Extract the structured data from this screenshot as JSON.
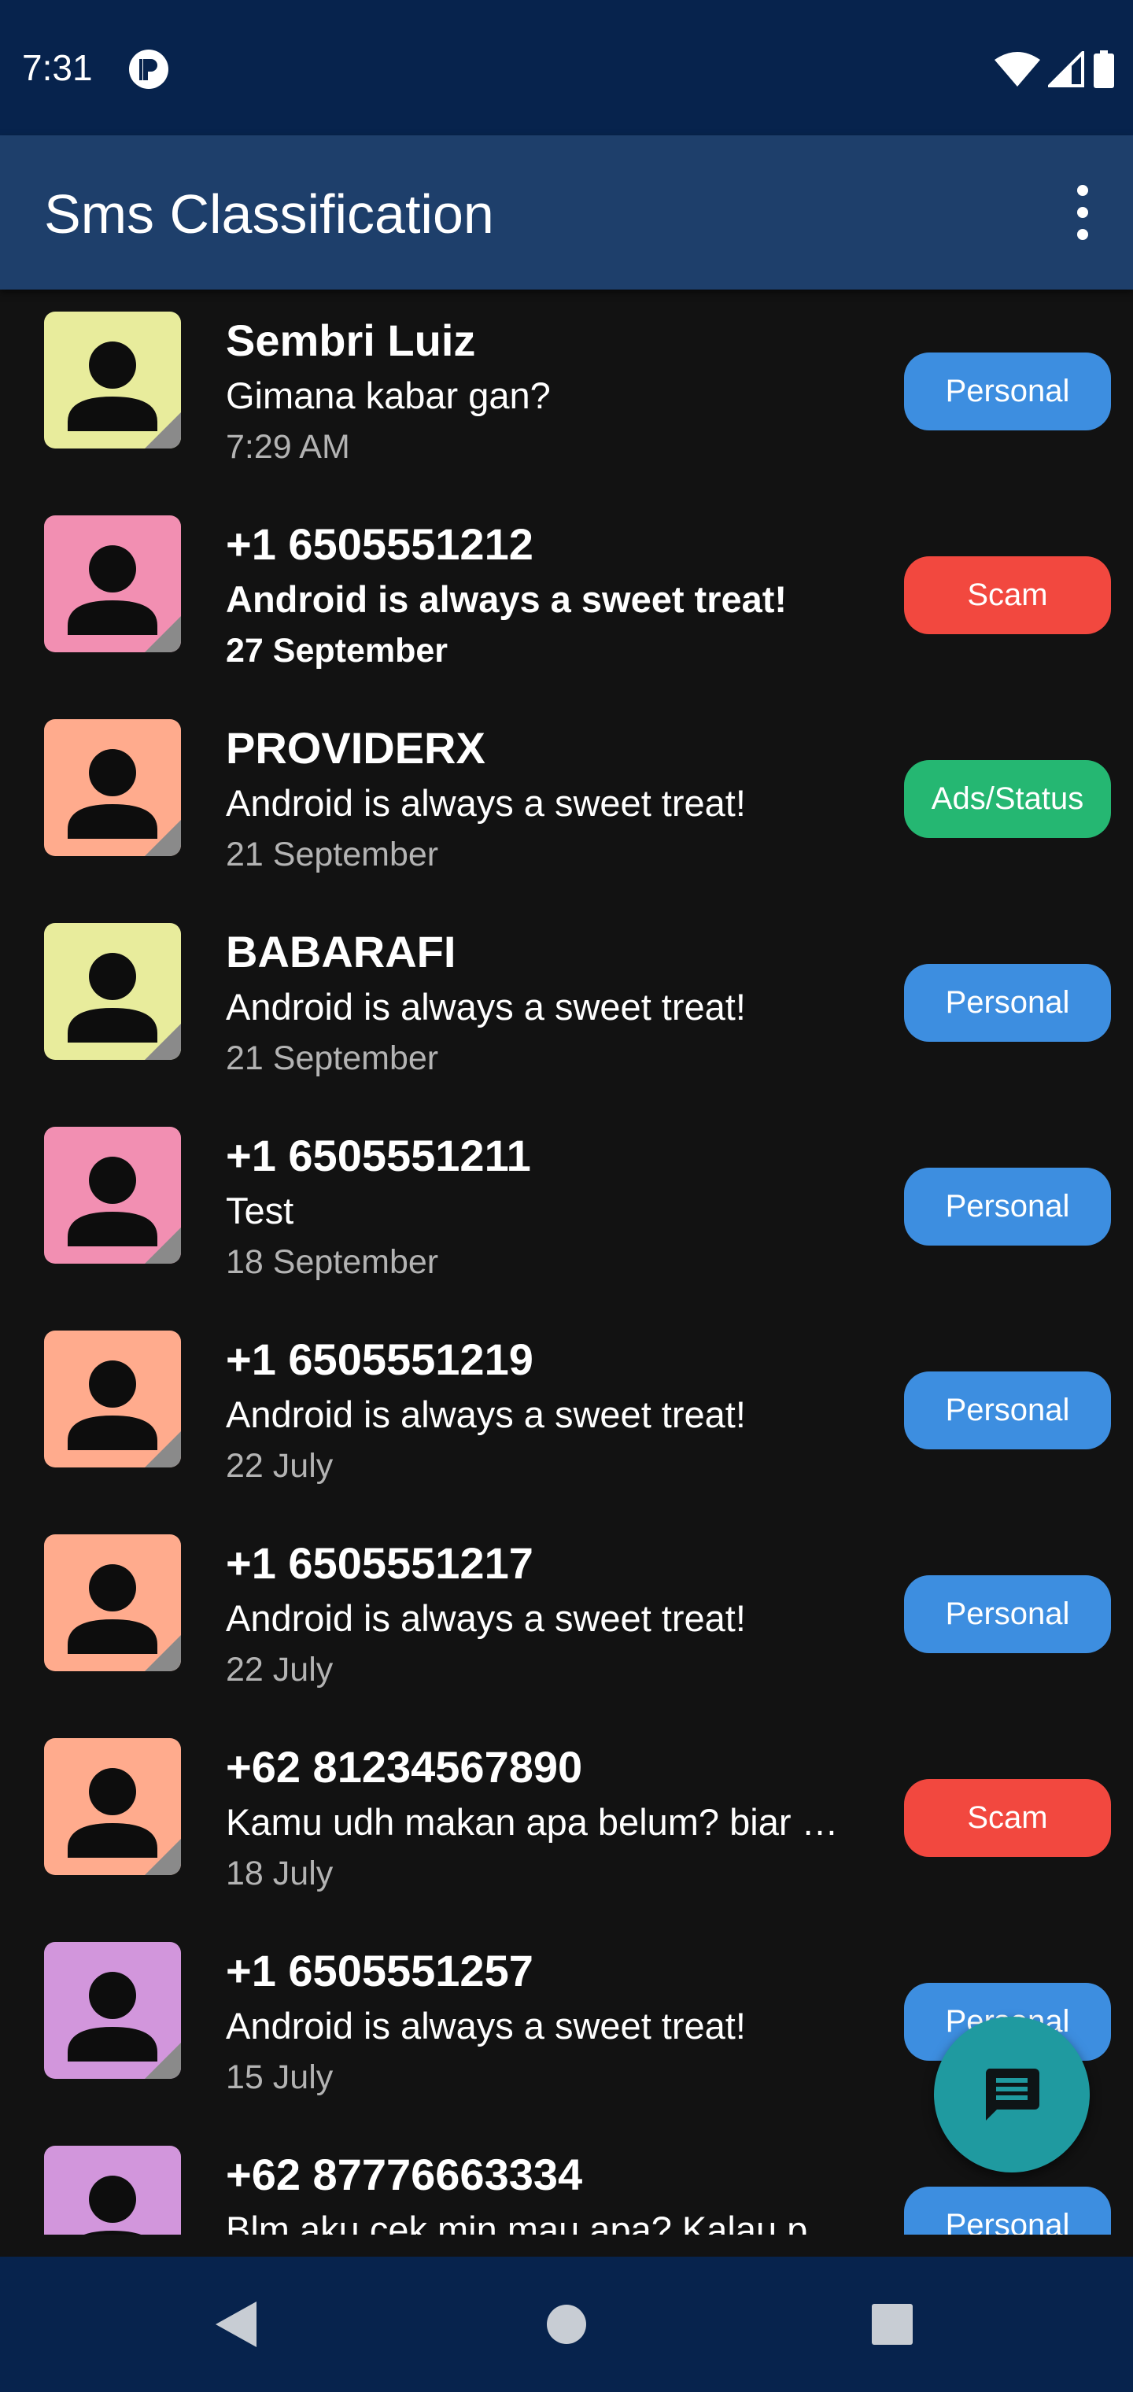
{
  "status_bar": {
    "time": "7:31",
    "app_icon": "privacy-p-icon",
    "icons": [
      "wifi-icon",
      "cell-signal-icon",
      "battery-icon"
    ]
  },
  "app_bar": {
    "title": "Sms Classification",
    "menu_icon": "more-vert-icon"
  },
  "colors": {
    "status_bar_bg": "#07234d",
    "app_bar_bg": "#1e3f6b",
    "background": "#121212",
    "personal": "#3d8ee0",
    "scam": "#f2483f",
    "ads_status": "#25b772",
    "fab": "#1f9aa0"
  },
  "messages": [
    {
      "sender": "Sembri Luiz",
      "snippet": "Gimana kabar gan?",
      "date": "7:29 AM",
      "label": "Personal",
      "label_color": "#3d8ee0",
      "avatar_color": "#e8ec9c",
      "unread": false
    },
    {
      "sender": "+1 6505551212",
      "snippet": "Android is always a sweet treat!",
      "date": "27 September",
      "label": "Scam",
      "label_color": "#f2483f",
      "avatar_color": "#f28fb2",
      "unread": true
    },
    {
      "sender": "PROVIDERX",
      "snippet": "Android is always a sweet treat!",
      "date": "21 September",
      "label": "Ads/Status",
      "label_color": "#25b772",
      "avatar_color": "#ffab8d",
      "unread": false
    },
    {
      "sender": "BABARAFI",
      "snippet": "Android is always a sweet treat!",
      "date": "21 September",
      "label": "Personal",
      "label_color": "#3d8ee0",
      "avatar_color": "#e8ec9c",
      "unread": false
    },
    {
      "sender": "+1 6505551211",
      "snippet": "Test",
      "date": "18 September",
      "label": "Personal",
      "label_color": "#3d8ee0",
      "avatar_color": "#f28fb2",
      "unread": false
    },
    {
      "sender": "+1 6505551219",
      "snippet": "Android is always a sweet treat!",
      "date": "22 July",
      "label": "Personal",
      "label_color": "#3d8ee0",
      "avatar_color": "#ffab8d",
      "unread": false
    },
    {
      "sender": "+1 6505551217",
      "snippet": "Android is always a sweet treat!",
      "date": "22 July",
      "label": "Personal",
      "label_color": "#3d8ee0",
      "avatar_color": "#ffab8d",
      "unread": false
    },
    {
      "sender": "+62 81234567890",
      "snippet": "Kamu udh makan apa belum? biar …",
      "date": "18 July",
      "label": "Scam",
      "label_color": "#f2483f",
      "avatar_color": "#ffab8d",
      "unread": false
    },
    {
      "sender": "+1 6505551257",
      "snippet": "Android is always a sweet treat!",
      "date": "15 July",
      "label": "Personal",
      "label_color": "#3d8ee0",
      "avatar_color": "#d296dc",
      "unread": false
    },
    {
      "sender": "+62 87776663334",
      "snippet": "Blm aku cek min mau apa? Kalau p…",
      "date": "",
      "label": "Personal",
      "label_color": "#3d8ee0",
      "avatar_color": "#d296dc",
      "unread": false
    }
  ],
  "fab": {
    "icon": "new-message-icon"
  },
  "nav_bar": {
    "icons": [
      "back-icon",
      "home-icon",
      "recents-icon"
    ]
  }
}
